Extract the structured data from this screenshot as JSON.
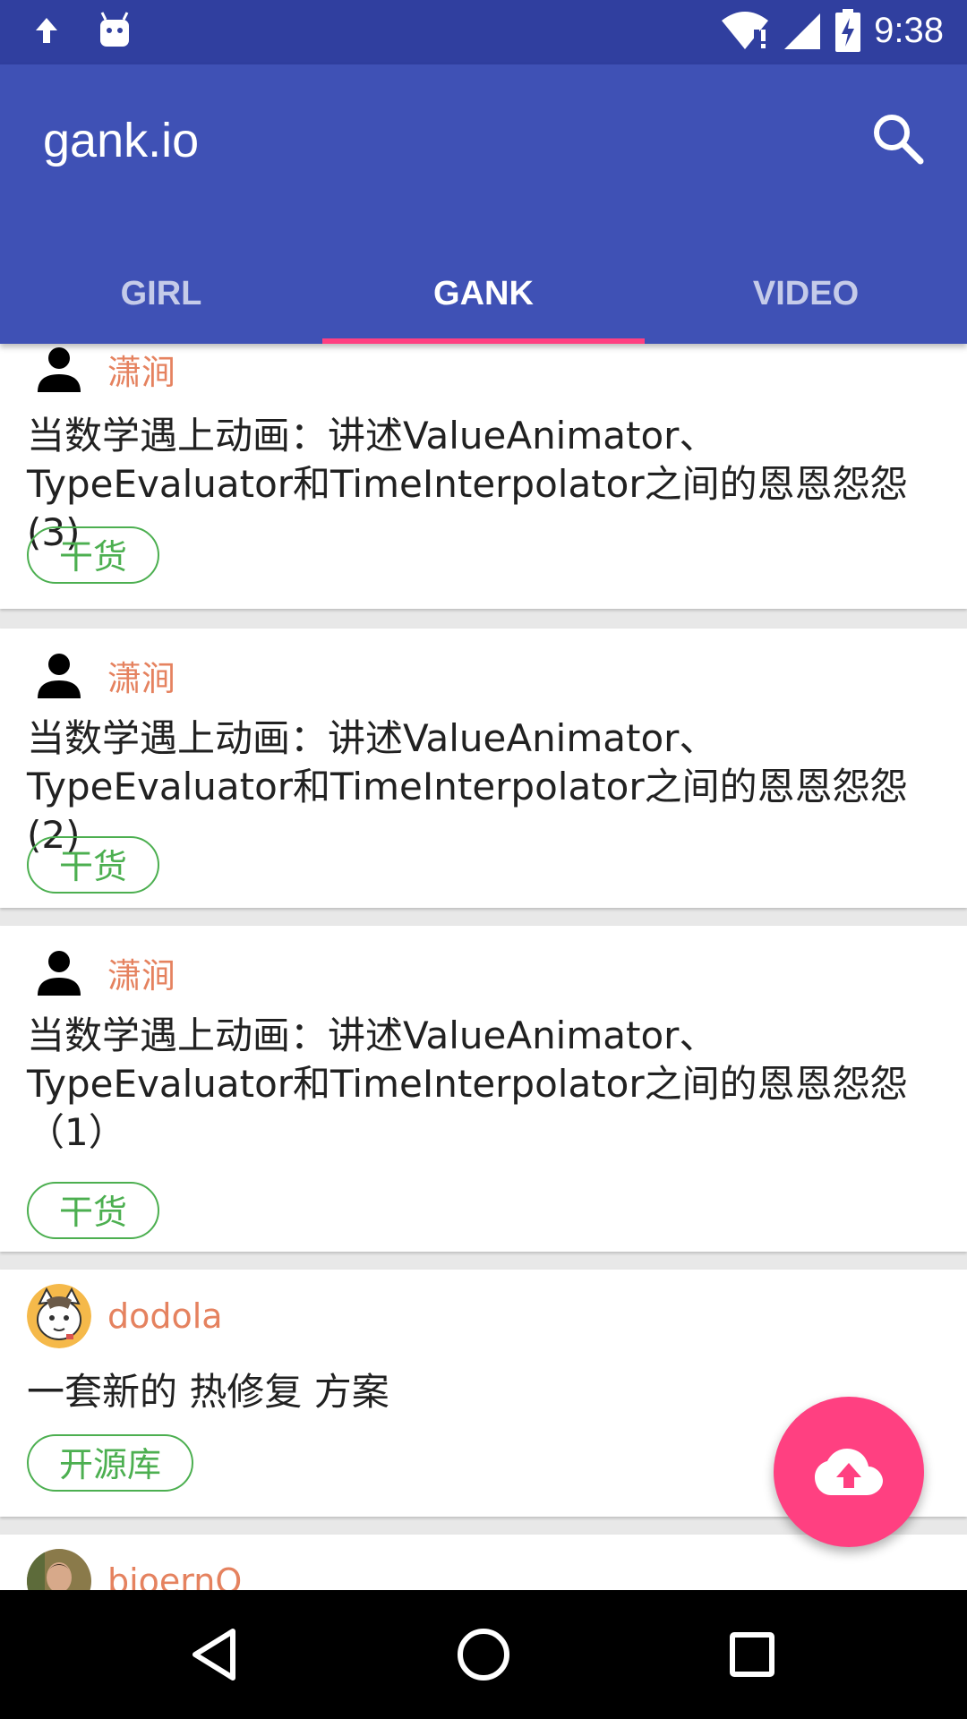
{
  "status_bar": {
    "time": "9:38",
    "icons": [
      "upload-arrow-icon",
      "android-icon",
      "wifi-alert-icon",
      "signal-icon",
      "battery-charging-icon"
    ]
  },
  "app_bar": {
    "title": "gank.io",
    "search_icon": "search-icon"
  },
  "tabs": [
    {
      "label": "GIRL",
      "active": false
    },
    {
      "label": "GANK",
      "active": true
    },
    {
      "label": "VIDEO",
      "active": false
    }
  ],
  "colors": {
    "primary": "#3f51b5",
    "primary_dark": "#303f9f",
    "accent": "#ff4081",
    "author": "#e5825f",
    "tag": "#4caf50"
  },
  "items": [
    {
      "author": "潇涧",
      "avatar": "person-icon",
      "desc": "当数学遇上动画：讲述ValueAnimator、TypeEvaluator和TimeInterpolator之间的恩恩怨怨(3)",
      "tag": "干货"
    },
    {
      "author": "潇涧",
      "avatar": "person-icon",
      "desc": "当数学遇上动画：讲述ValueAnimator、TypeEvaluator和TimeInterpolator之间的恩恩怨怨(2)",
      "tag": "干货"
    },
    {
      "author": "潇涧",
      "avatar": "person-icon",
      "desc": "当数学遇上动画：讲述ValueAnimator、TypeEvaluator和TimeInterpolator之间的恩恩怨怨（1）",
      "tag": "干货"
    },
    {
      "author": "dodola",
      "avatar": "cat-avatar",
      "desc": "一套新的 热修复 方案",
      "tag": "开源库"
    },
    {
      "author": "bjoernQ",
      "avatar": "photo-avatar",
      "desc": "",
      "tag": ""
    }
  ],
  "fab": {
    "icon": "cloud-upload-icon"
  },
  "nav_bar": {
    "icons": [
      "back-icon",
      "home-icon",
      "recents-icon"
    ]
  }
}
